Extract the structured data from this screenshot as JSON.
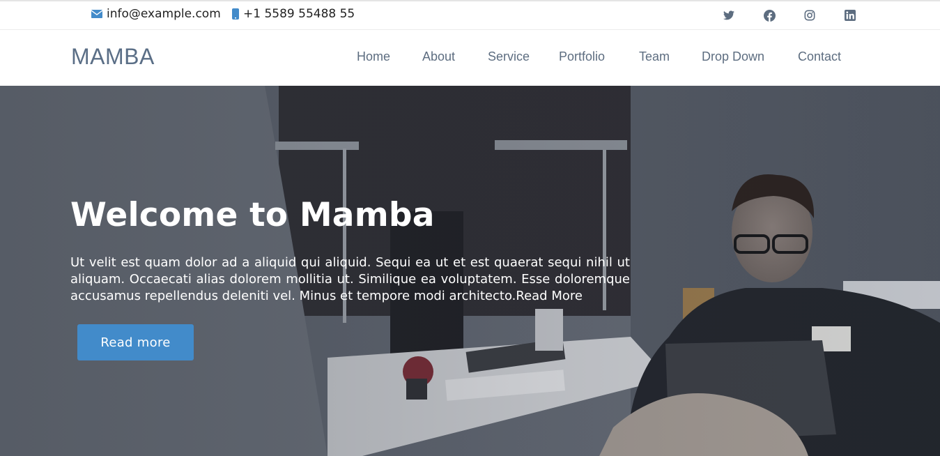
{
  "topbar": {
    "email": "info@example.com",
    "phone": "+1 5589 55488 55",
    "email_icon": "envelope-icon",
    "phone_icon": "mobile-phone-icon",
    "socials": [
      "twitter-icon",
      "facebook-icon",
      "instagram-icon",
      "linkedin-icon"
    ]
  },
  "header": {
    "logo": "MAMBA",
    "nav": [
      "Home",
      "About",
      "Service",
      "Portfolio",
      "Team",
      "Drop Down",
      "Contact"
    ]
  },
  "hero": {
    "title": "Welcome to Mamba",
    "text": "Ut velit est quam dolor ad a aliquid qui aliquid. Sequi ea ut et est quaerat sequi nihil ut aliquam. Occaecati alias dolorem mollitia ut. Similique ea voluptatem. Esse doloremque accusamus repellendus deleniti vel. Minus et tempore modi architecto.",
    "inline_link": "Read More",
    "button": "Read more"
  },
  "colors": {
    "brand": "#428bca",
    "nav_text": "#5d6d80",
    "logo": "#5a6e86",
    "icon": "#5d6d80"
  }
}
